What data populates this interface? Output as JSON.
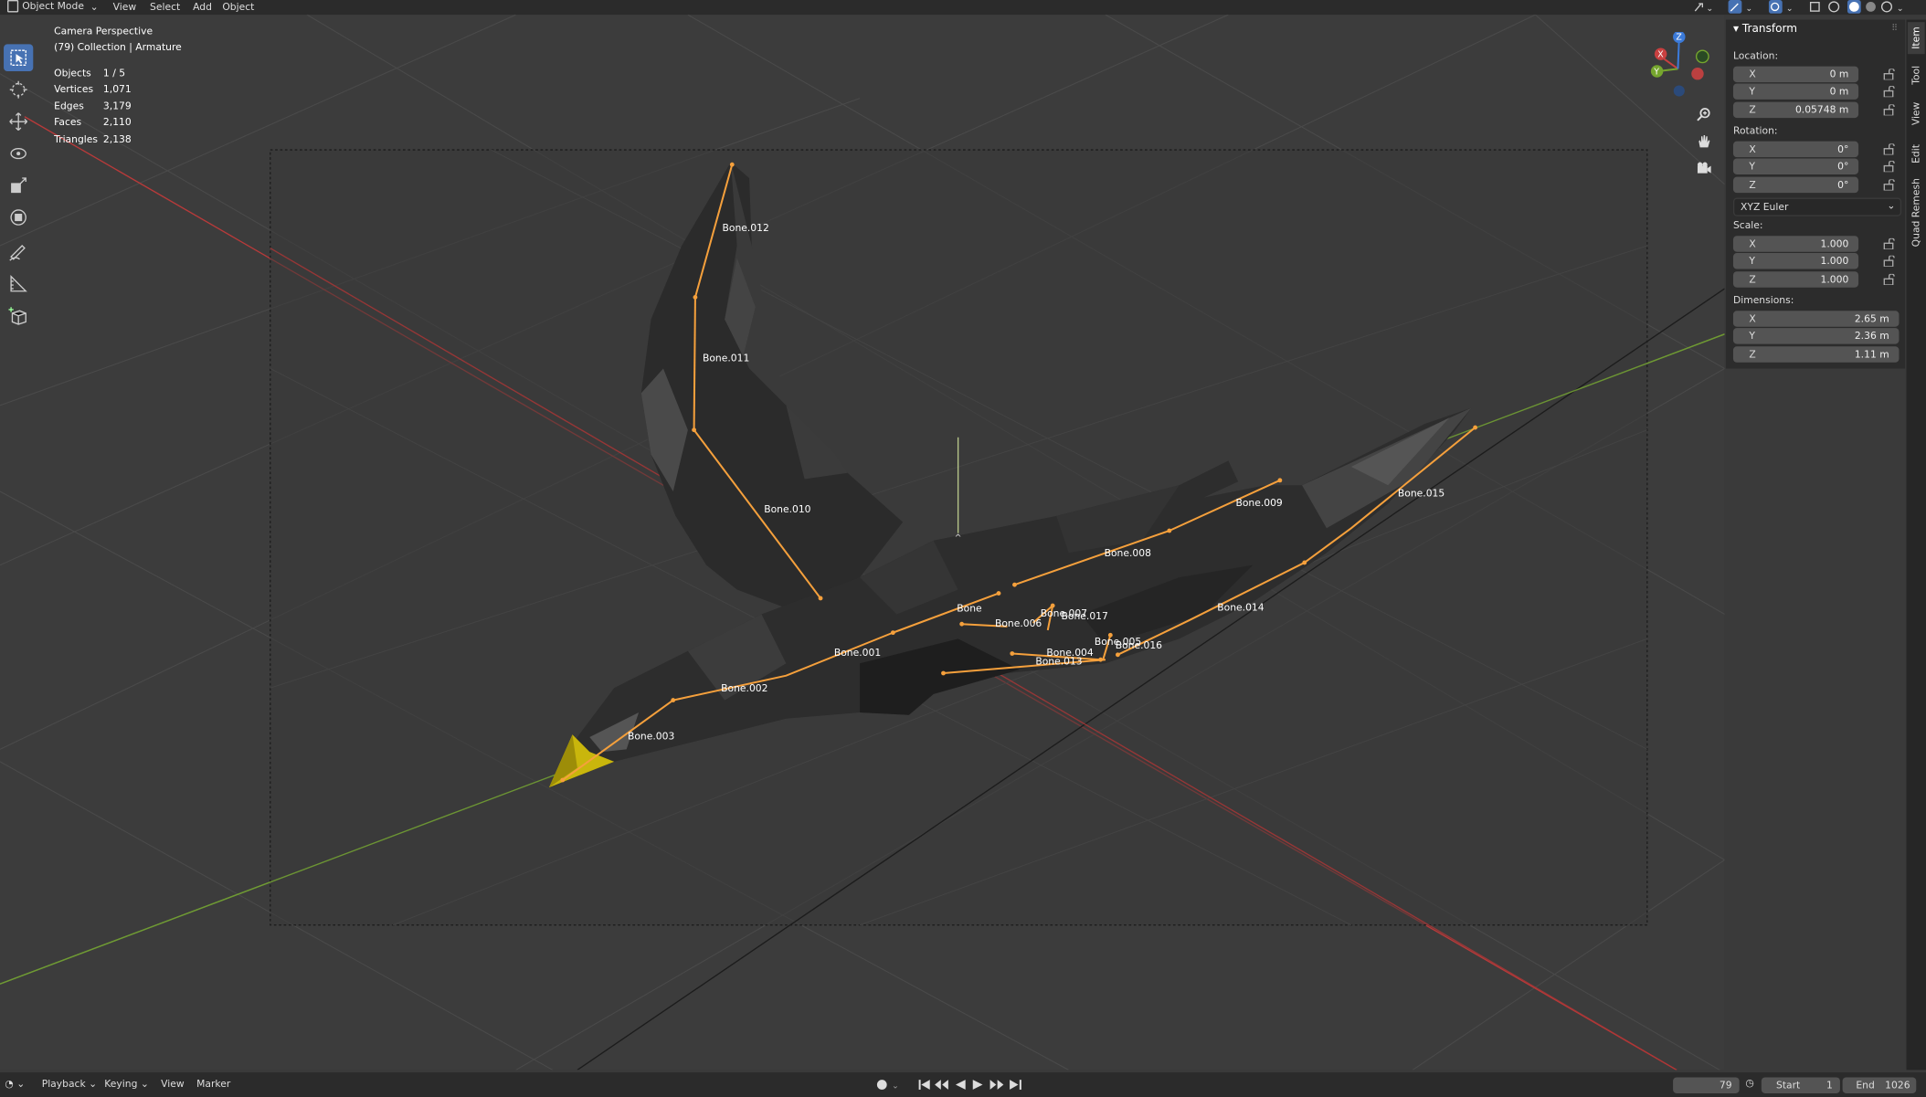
{
  "header": {
    "mode": "Object Mode",
    "menu": [
      "View",
      "Select",
      "Add",
      "Object"
    ]
  },
  "viewport": {
    "perspective": "Camera Perspective",
    "collection": "(79) Collection | Armature",
    "stats": [
      {
        "label": "Objects",
        "value": "1 / 5"
      },
      {
        "label": "Vertices",
        "value": "1,071"
      },
      {
        "label": "Edges",
        "value": "3,179"
      },
      {
        "label": "Faces",
        "value": "2,110"
      },
      {
        "label": "Triangles",
        "value": "2,138"
      }
    ],
    "gizmo_axes": [
      "X",
      "Y",
      "Z"
    ],
    "bones": [
      "Bone.012",
      "Bone.011",
      "Bone.010",
      "Bone.009",
      "Bone.008",
      "Bone.015",
      "Bone",
      "Bone.007",
      "Bone.017",
      "Bone.006",
      "Bone.014",
      "Bone.001",
      "Bone.004",
      "Bone.005",
      "Bone.016",
      "Bone.013",
      "Bone.002",
      "Bone.003"
    ]
  },
  "npanel": {
    "title": "Transform",
    "location_label": "Location:",
    "location": [
      {
        "axis": "X",
        "value": "0 m"
      },
      {
        "axis": "Y",
        "value": "0 m"
      },
      {
        "axis": "Z",
        "value": "0.05748 m"
      }
    ],
    "rotation_label": "Rotation:",
    "rotation": [
      {
        "axis": "X",
        "value": "0°"
      },
      {
        "axis": "Y",
        "value": "0°"
      },
      {
        "axis": "Z",
        "value": "0°"
      }
    ],
    "rotation_mode": "XYZ Euler",
    "scale_label": "Scale:",
    "scale": [
      {
        "axis": "X",
        "value": "1.000"
      },
      {
        "axis": "Y",
        "value": "1.000"
      },
      {
        "axis": "Z",
        "value": "1.000"
      }
    ],
    "dimensions_label": "Dimensions:",
    "dimensions": [
      {
        "axis": "X",
        "value": "2.65 m"
      },
      {
        "axis": "Y",
        "value": "2.36 m"
      },
      {
        "axis": "Z",
        "value": "1.11 m"
      }
    ],
    "tabs": [
      "Item",
      "Tool",
      "View",
      "Edit",
      "Quad Remesh"
    ]
  },
  "timeline": {
    "playback": "Playback",
    "keying": "Keying",
    "view": "View",
    "marker": "Marker",
    "current_frame": "79",
    "start_label": "Start",
    "start": "1",
    "end_label": "End",
    "end": "1026"
  },
  "colors": {
    "accent": "#4772b3",
    "bone": "#f5a03c",
    "axis_x": "#c8393a",
    "axis_y": "#76a62e",
    "beak": "#d4c00a"
  }
}
